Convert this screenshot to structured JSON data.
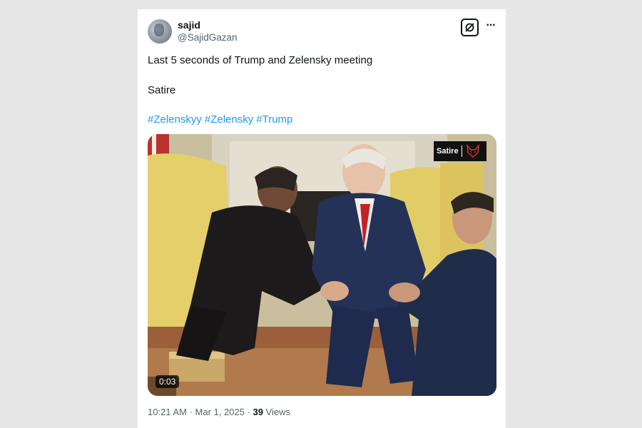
{
  "post": {
    "author_name": "sajid",
    "author_handle": "@SajidGazan",
    "text_line1": "Last 5 seconds of Trump and Zelensky meeting",
    "text_line2": "Satire",
    "hashtags": [
      "#Zelenskyy",
      "#Zelensky",
      "#Trump"
    ],
    "grok_icon": "grok-icon",
    "more_icon": "more-dots-icon"
  },
  "media": {
    "duration": "0:03",
    "watermark_text": "Satire",
    "watermark_logo": "fox-logo-icon"
  },
  "meta": {
    "time": "10:21 AM",
    "separator": "·",
    "date": "Mar 1, 2025",
    "views_count": "39",
    "views_label": "Views"
  },
  "colors": {
    "link": "#1d9bf0",
    "secondary_text": "#536471",
    "primary_text": "#0f1419"
  }
}
